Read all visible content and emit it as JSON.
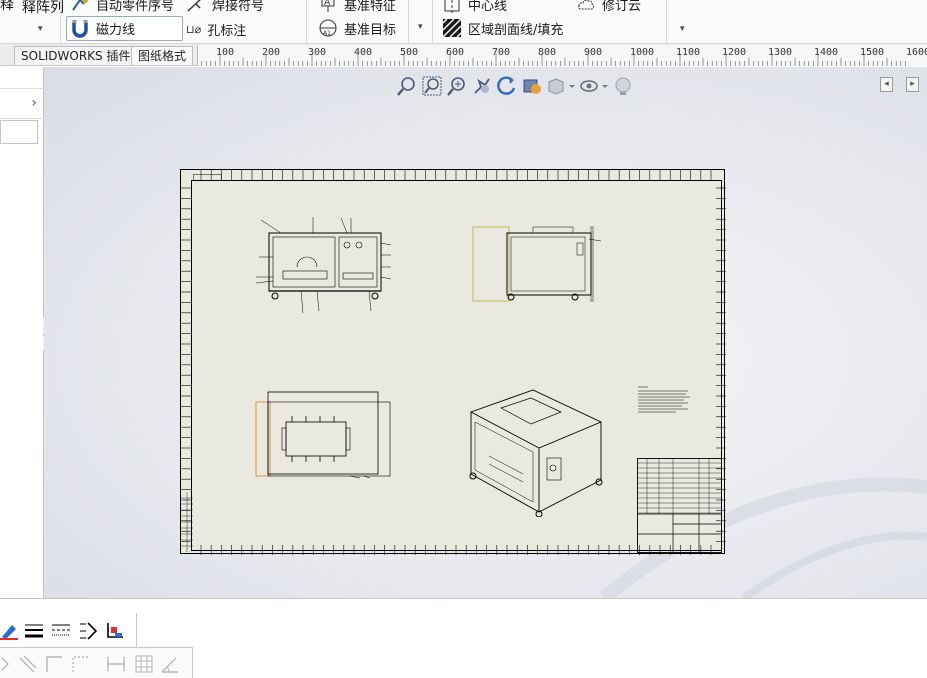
{
  "ribbon": {
    "annot_array_label": "释阵列",
    "annot_label_clipped": "释",
    "auto_balloon_label": "自动零件序号",
    "weld_symbol_label": "焊接符号",
    "magnetic_line_label": "磁力线",
    "hole_callout_label": "孔标注",
    "datum_feature_label": "基准特征",
    "datum_target_label": "基准目标",
    "centerline_label": "中心线",
    "area_hatch_label": "区域剖面线/填充",
    "revision_cloud_label": "修订云",
    "hole_callout_prefix": "⊔⌀"
  },
  "tabs": [
    {
      "label": "SOLIDWORKS 插件"
    },
    {
      "label": "图纸格式"
    }
  ],
  "ruler": {
    "ticks": [
      "100",
      "200",
      "300",
      "400",
      "500",
      "600",
      "700",
      "800",
      "900",
      "1000",
      "1100",
      "1200",
      "1300",
      "1400",
      "1500",
      "1600"
    ]
  },
  "colors": {
    "sheet_bg": "#e9e9df",
    "view_highlight": "#b5b03a",
    "selected_view": "#e8882a",
    "ribbon_bg": "#fbfbfb"
  },
  "hud_icons": [
    "zoom-to-fit-icon",
    "zoom-to-area-icon",
    "zoom-in-out-icon",
    "pan-icon",
    "rotate-icon",
    "previous-view-icon",
    "display-style-icon",
    "hide-show-icon",
    "appearance-icon"
  ]
}
